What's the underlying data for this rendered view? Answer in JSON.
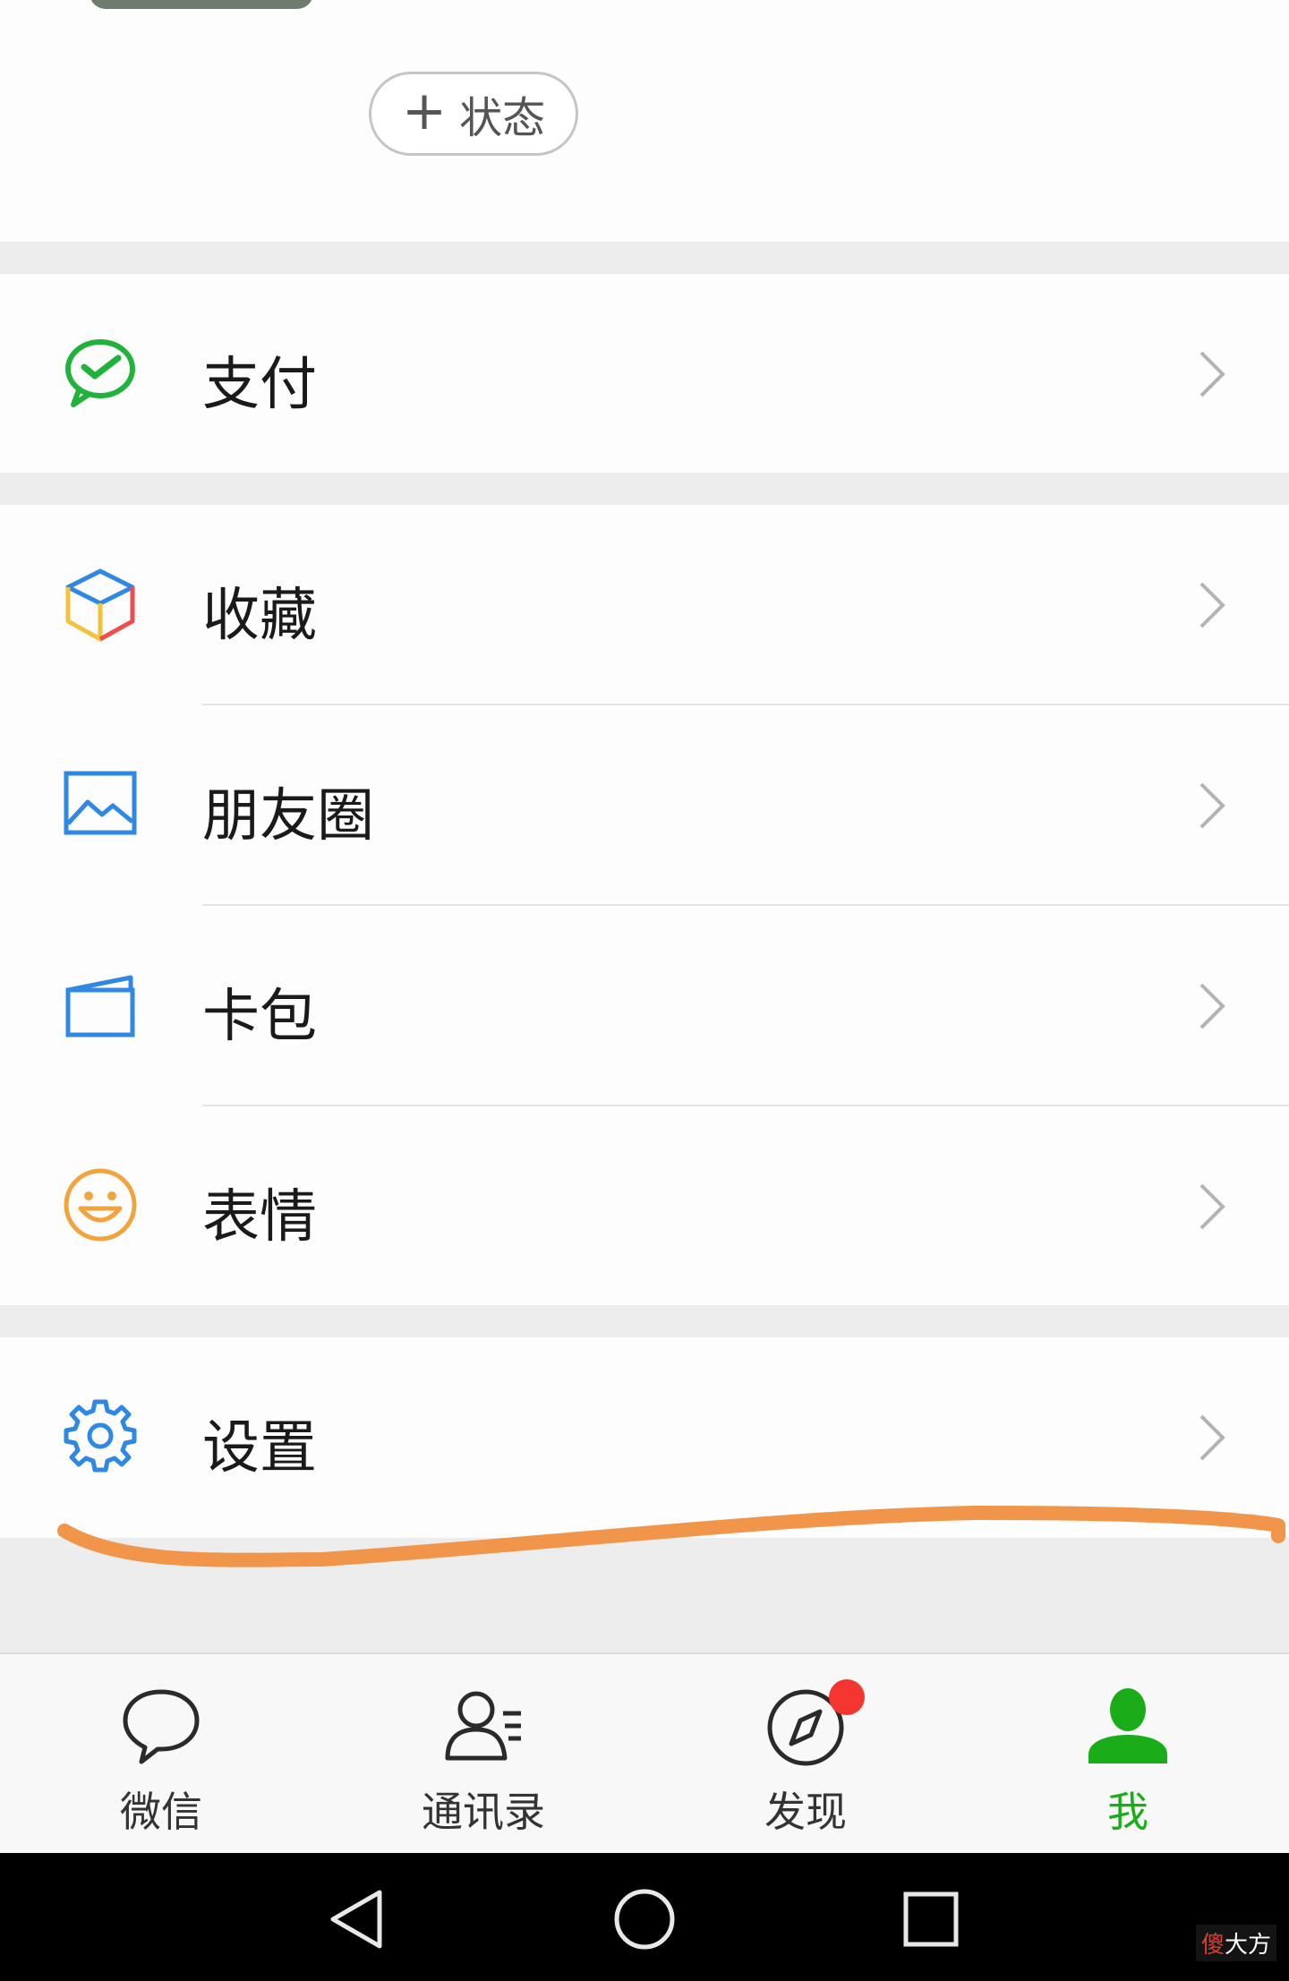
{
  "header": {
    "status_button": {
      "plus": "+",
      "label": "状态"
    }
  },
  "menu": {
    "pay": "支付",
    "favorites": "收藏",
    "moments": "朋友圈",
    "cards": "卡包",
    "stickers": "表情",
    "settings": "设置"
  },
  "icons": {
    "pay": "wechat-pay-icon",
    "favorites": "cube-icon",
    "moments": "picture-icon",
    "cards": "card-wallet-icon",
    "stickers": "smiley-icon",
    "settings": "gear-icon",
    "chevron": "chevron-right-icon"
  },
  "tabs": [
    {
      "label": "微信",
      "icon": "chat-bubble-icon",
      "active": false
    },
    {
      "label": "通讯录",
      "icon": "contacts-icon",
      "active": false
    },
    {
      "label": "发现",
      "icon": "compass-icon",
      "active": false,
      "badge": true
    },
    {
      "label": "我",
      "icon": "person-icon",
      "active": true
    }
  ],
  "watermark": {
    "part1": "傻",
    "part2": "大方"
  },
  "colors": {
    "active_green": "#1aad19",
    "badge_red": "#f43530",
    "annotation_orange": "#f0954a",
    "pay_green": "#20b23a",
    "icon_blue": "#2f88e4",
    "smiley_orange": "#f3a33c"
  }
}
